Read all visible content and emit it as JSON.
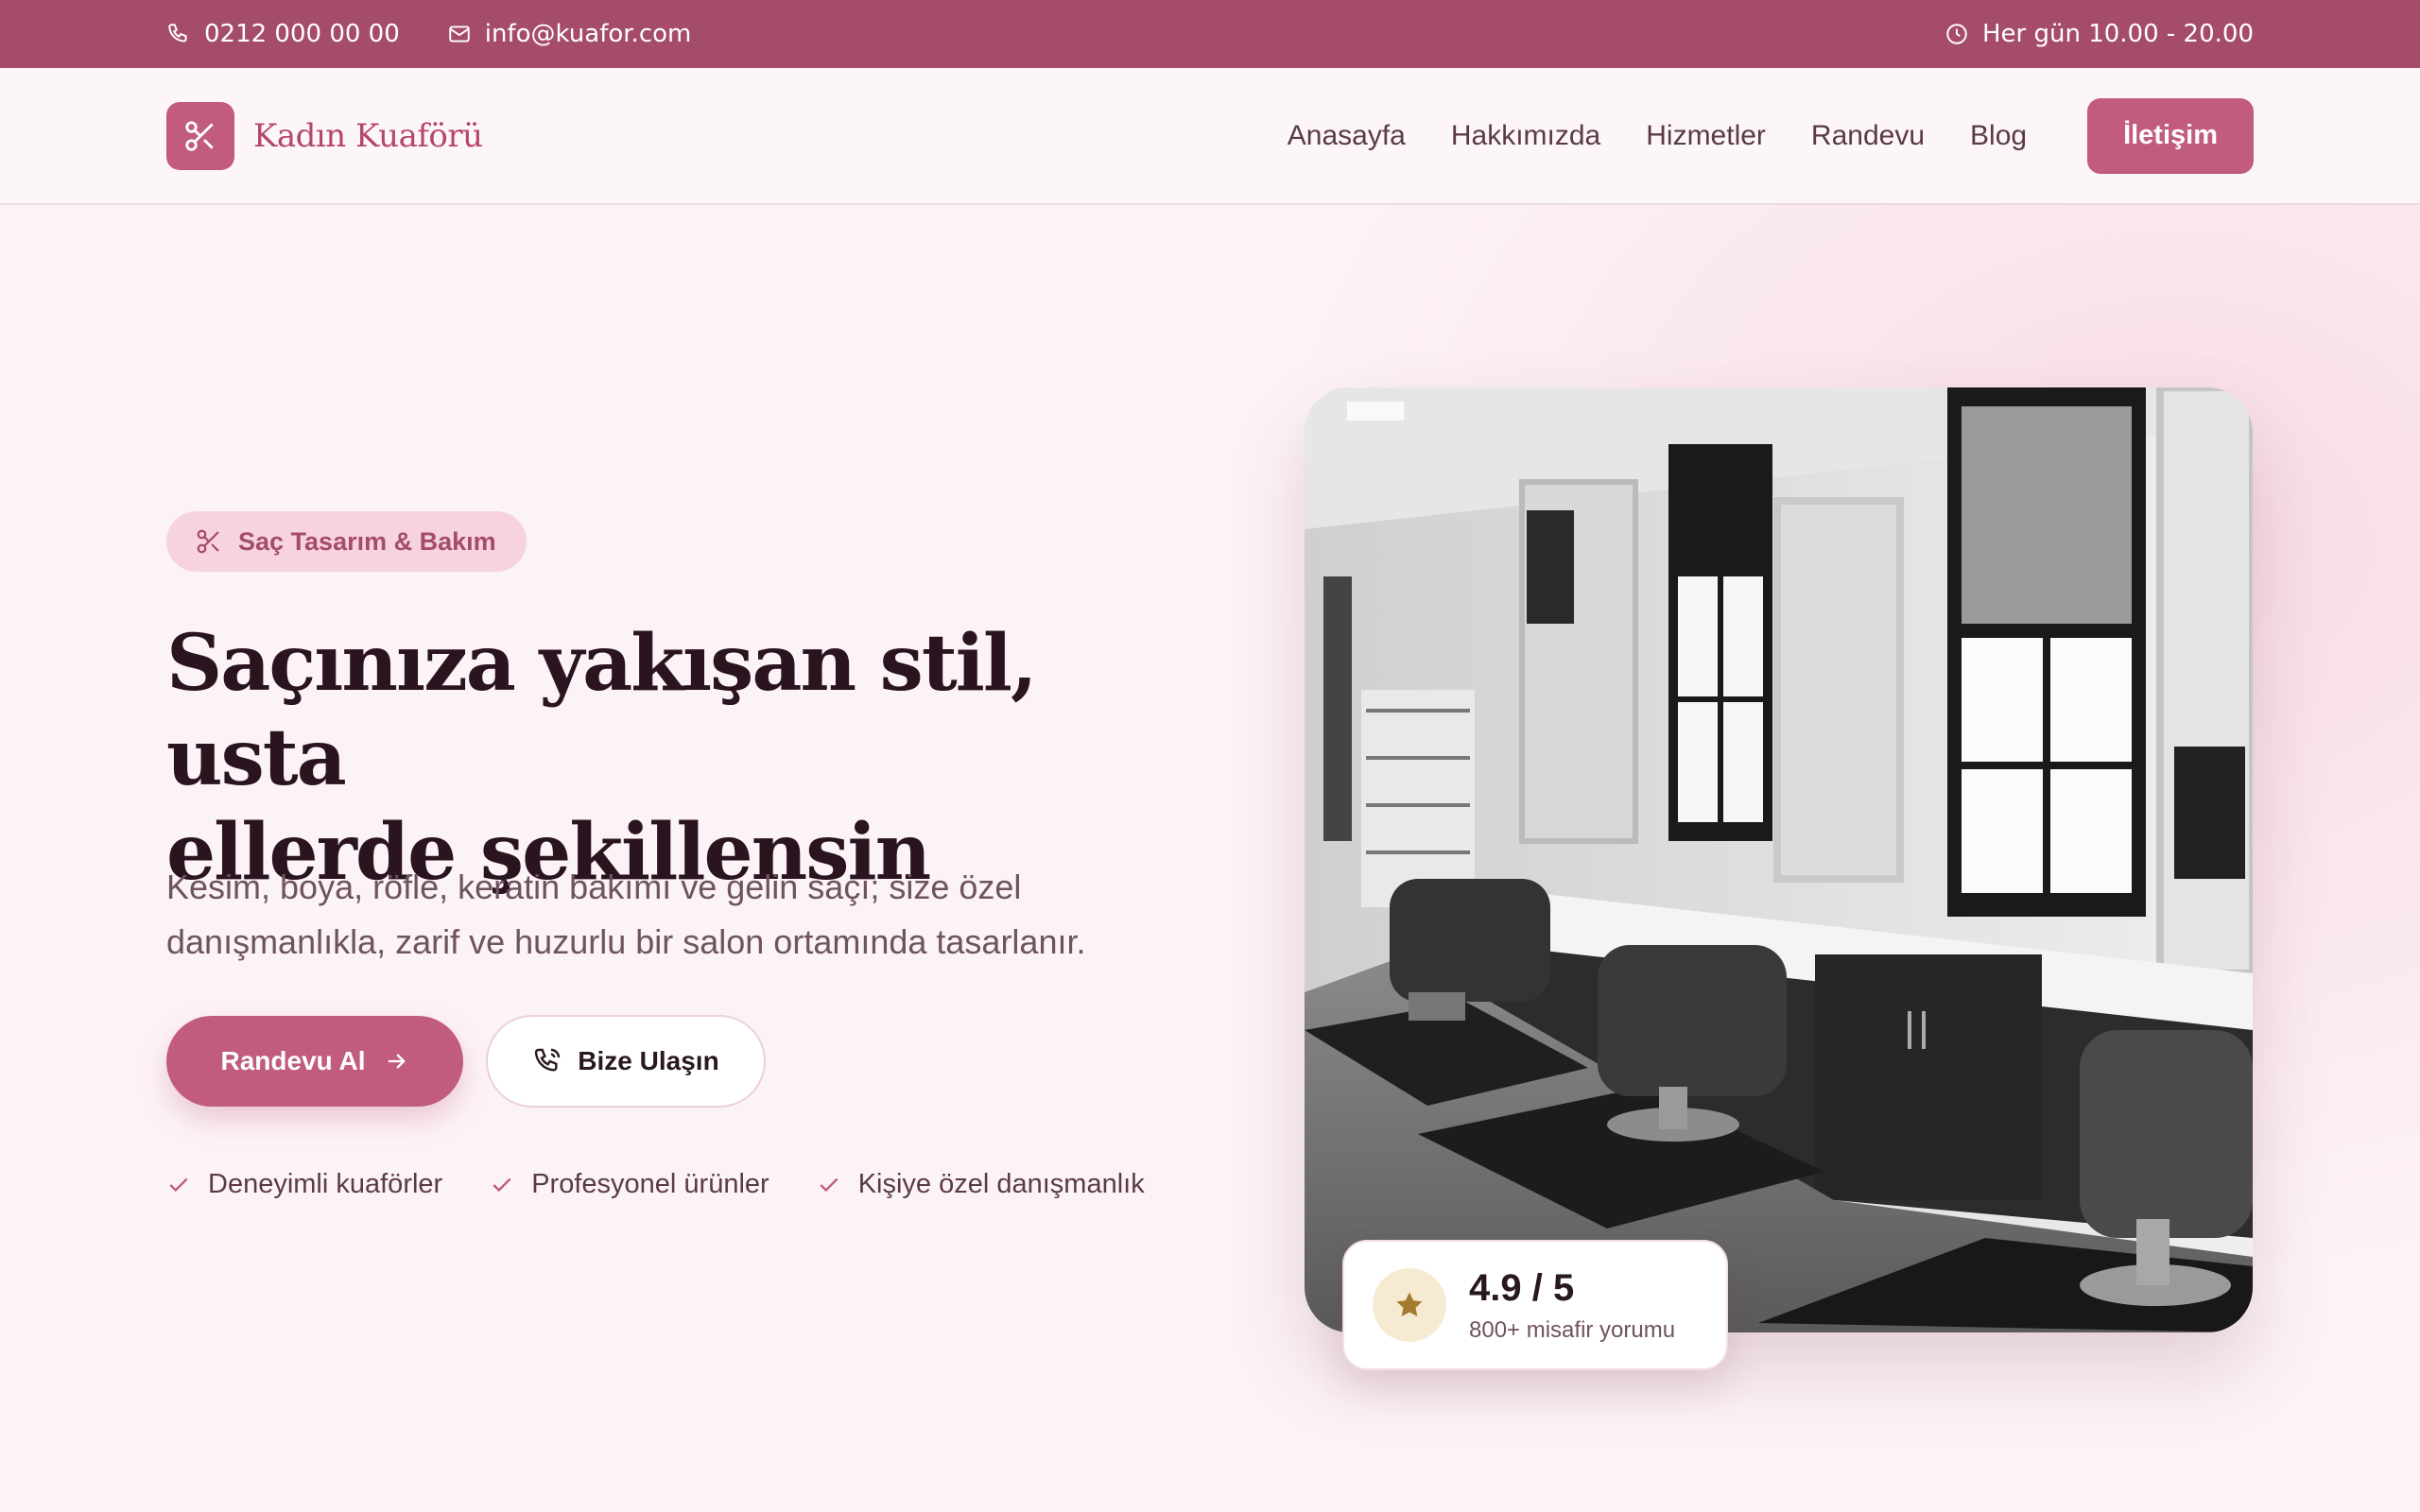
{
  "topbar": {
    "phone": "0212 000 00 00",
    "email": "info@kuafor.com",
    "hours": "Her gün 10.00 - 20.00"
  },
  "header": {
    "brand": "Kadın Kuaförü",
    "nav": [
      "Anasayfa",
      "Hakkımızda",
      "Hizmetler",
      "Randevu",
      "Blog"
    ],
    "cta": "İletişim"
  },
  "hero": {
    "badge": "Saç Tasarım & Bakım",
    "headline_line1": "Saçınıza yakışan stil, usta",
    "headline_line2": "ellerde şekillensin",
    "subtitle": "Kesim, boya, röfle, keratin bakımı ve gelin saçı; size özel danışmanlıkla, zarif ve huzurlu bir salon ortamında tasarlanır.",
    "primary_button": "Randevu Al",
    "secondary_button": "Bize Ulaşın",
    "features": [
      "Deneyimli kuaförler",
      "Profesyonel ürünler",
      "Kişiye özel danışmanlık"
    ]
  },
  "rating": {
    "score": "4.9 / 5",
    "count": "800+ misafir yorumu"
  },
  "colors": {
    "brand": "#a54c69",
    "accent": "#c15c80",
    "background": "#fcf3f6"
  },
  "icons": [
    "phone-icon",
    "mail-icon",
    "clock-icon",
    "scissors-icon",
    "arrow-right-icon",
    "phone-call-icon",
    "check-icon",
    "star-icon"
  ]
}
